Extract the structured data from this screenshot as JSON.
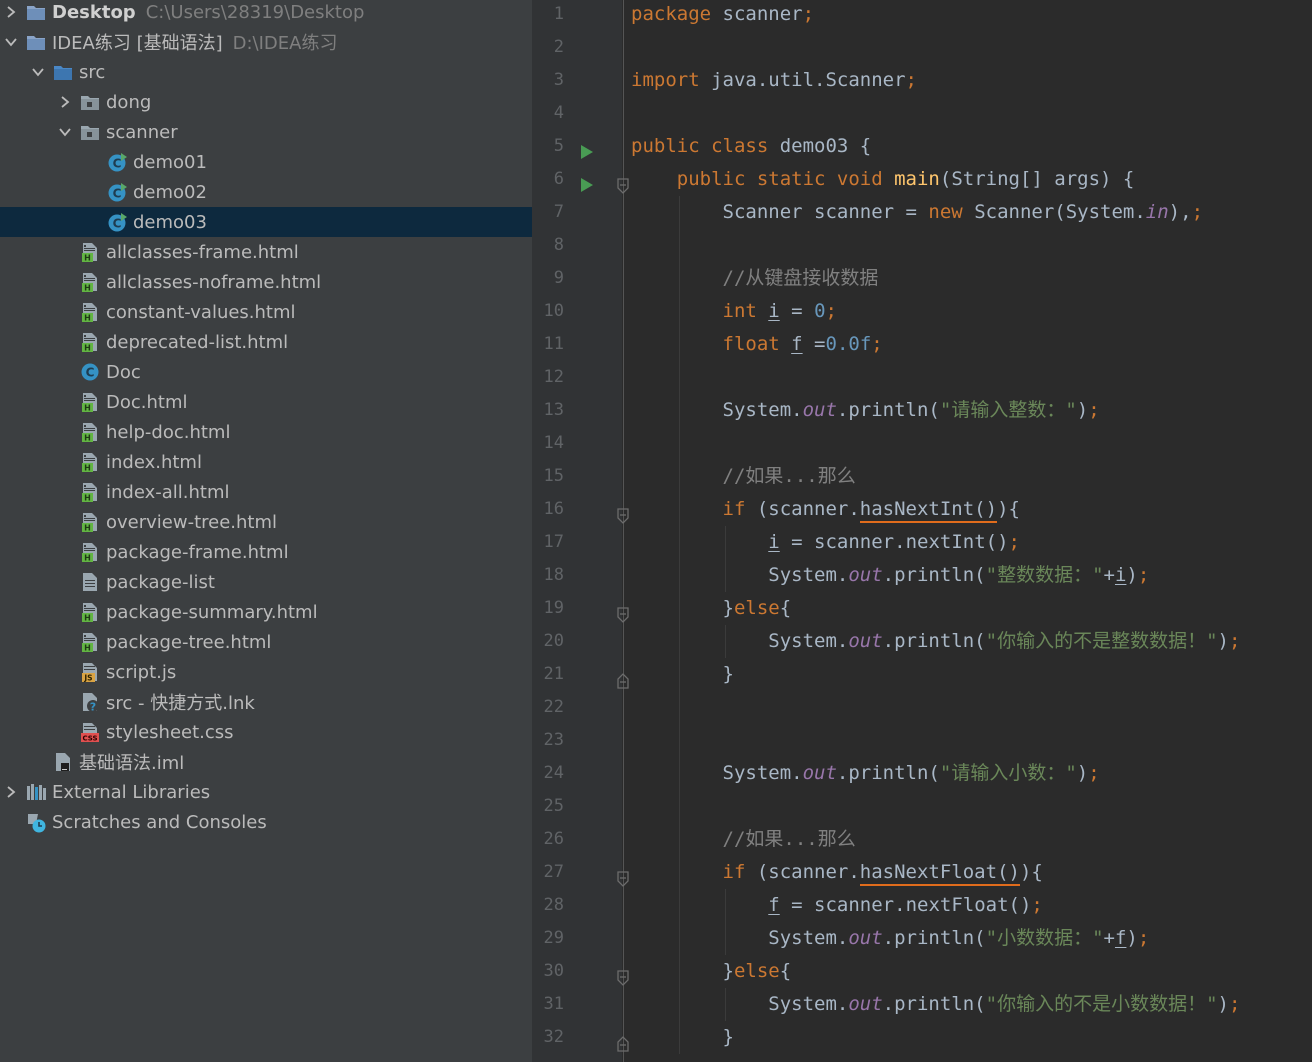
{
  "project_tree": [
    {
      "label": "Desktop",
      "hint": "C:\\Users\\28319\\Desktop",
      "depth": 0,
      "arrow": "right",
      "icon": "module-folder-icon",
      "bold": true
    },
    {
      "label": "IDEA练习 [基础语法]",
      "hint": "D:\\IDEA练习",
      "depth": 0,
      "arrow": "down",
      "icon": "module-folder-icon",
      "bold": false
    },
    {
      "label": "src",
      "hint": "",
      "depth": 1,
      "arrow": "down",
      "icon": "source-folder-icon"
    },
    {
      "label": "dong",
      "hint": "",
      "depth": 2,
      "arrow": "right",
      "icon": "package-icon"
    },
    {
      "label": "scanner",
      "hint": "",
      "depth": 2,
      "arrow": "down",
      "icon": "package-icon"
    },
    {
      "label": "demo01",
      "hint": "",
      "depth": 3,
      "arrow": "",
      "icon": "java-class-run-icon"
    },
    {
      "label": "demo02",
      "hint": "",
      "depth": 3,
      "arrow": "",
      "icon": "java-class-run-icon"
    },
    {
      "label": "demo03",
      "hint": "",
      "depth": 3,
      "arrow": "",
      "icon": "java-class-run-icon",
      "selected": true
    },
    {
      "label": "allclasses-frame.html",
      "hint": "",
      "depth": 2,
      "arrow": "",
      "icon": "html-file-icon"
    },
    {
      "label": "allclasses-noframe.html",
      "hint": "",
      "depth": 2,
      "arrow": "",
      "icon": "html-file-icon"
    },
    {
      "label": "constant-values.html",
      "hint": "",
      "depth": 2,
      "arrow": "",
      "icon": "html-file-icon"
    },
    {
      "label": "deprecated-list.html",
      "hint": "",
      "depth": 2,
      "arrow": "",
      "icon": "html-file-icon"
    },
    {
      "label": "Doc",
      "hint": "",
      "depth": 2,
      "arrow": "",
      "icon": "java-class-icon"
    },
    {
      "label": "Doc.html",
      "hint": "",
      "depth": 2,
      "arrow": "",
      "icon": "html-file-icon"
    },
    {
      "label": "help-doc.html",
      "hint": "",
      "depth": 2,
      "arrow": "",
      "icon": "html-file-icon"
    },
    {
      "label": "index.html",
      "hint": "",
      "depth": 2,
      "arrow": "",
      "icon": "html-file-icon"
    },
    {
      "label": "index-all.html",
      "hint": "",
      "depth": 2,
      "arrow": "",
      "icon": "html-file-icon"
    },
    {
      "label": "overview-tree.html",
      "hint": "",
      "depth": 2,
      "arrow": "",
      "icon": "html-file-icon"
    },
    {
      "label": "package-frame.html",
      "hint": "",
      "depth": 2,
      "arrow": "",
      "icon": "html-file-icon"
    },
    {
      "label": "package-list",
      "hint": "",
      "depth": 2,
      "arrow": "",
      "icon": "text-file-icon"
    },
    {
      "label": "package-summary.html",
      "hint": "",
      "depth": 2,
      "arrow": "",
      "icon": "html-file-icon"
    },
    {
      "label": "package-tree.html",
      "hint": "",
      "depth": 2,
      "arrow": "",
      "icon": "html-file-icon"
    },
    {
      "label": "script.js",
      "hint": "",
      "depth": 2,
      "arrow": "",
      "icon": "js-file-icon"
    },
    {
      "label": "src - 快捷方式.lnk",
      "hint": "",
      "depth": 2,
      "arrow": "",
      "icon": "unknown-file-icon"
    },
    {
      "label": "stylesheet.css",
      "hint": "",
      "depth": 2,
      "arrow": "",
      "icon": "css-file-icon"
    },
    {
      "label": "基础语法.iml",
      "hint": "",
      "depth": 1,
      "arrow": "",
      "icon": "iml-file-icon"
    },
    {
      "label": "External Libraries",
      "hint": "",
      "depth": 0,
      "arrow": "right",
      "icon": "libraries-icon"
    },
    {
      "label": "Scratches and Consoles",
      "hint": "",
      "depth": 0,
      "arrow": "",
      "icon": "scratches-icon"
    }
  ],
  "editor": {
    "lines": [
      {
        "n": "1",
        "run": false,
        "fold": "",
        "guides": [],
        "tokens": [
          [
            "kw",
            "package "
          ],
          [
            "",
            "scanner"
          ],
          [
            "kw",
            ";"
          ]
        ]
      },
      {
        "n": "2",
        "run": false,
        "fold": "",
        "guides": [],
        "tokens": []
      },
      {
        "n": "3",
        "run": false,
        "fold": "",
        "guides": [],
        "tokens": [
          [
            "kw",
            "import "
          ],
          [
            "",
            "java.util.Scanner"
          ],
          [
            "kw",
            ";"
          ]
        ]
      },
      {
        "n": "4",
        "run": false,
        "fold": "",
        "guides": [],
        "tokens": []
      },
      {
        "n": "5",
        "run": true,
        "fold": "",
        "guides": [],
        "tokens": [
          [
            "kw",
            "public class "
          ],
          [
            "",
            "demo03 {"
          ]
        ]
      },
      {
        "n": "6",
        "run": true,
        "fold": "open",
        "guides": [],
        "tokens": [
          [
            "",
            "    "
          ],
          [
            "kw",
            "public static void "
          ],
          [
            "fn",
            "main"
          ],
          [
            "",
            "(String[] args) {"
          ]
        ]
      },
      {
        "n": "7",
        "run": false,
        "fold": "",
        "guides": [
          1
        ],
        "tokens": [
          [
            "",
            "        Scanner scanner = "
          ],
          [
            "kw",
            "new "
          ],
          [
            "",
            "Scanner(System."
          ],
          [
            "field",
            "in"
          ],
          [
            "",
            "),"
          ],
          [
            "kw",
            ";"
          ]
        ]
      },
      {
        "n": "8",
        "run": false,
        "fold": "",
        "guides": [
          1
        ],
        "tokens": []
      },
      {
        "n": "9",
        "run": false,
        "fold": "",
        "guides": [
          1
        ],
        "tokens": [
          [
            "",
            "        "
          ],
          [
            "cmt",
            "//从键盘接收数据"
          ]
        ]
      },
      {
        "n": "10",
        "run": false,
        "fold": "",
        "guides": [
          1
        ],
        "tokens": [
          [
            "",
            "        "
          ],
          [
            "kw",
            "int "
          ],
          [
            "var-ul",
            "i"
          ],
          [
            "",
            " = "
          ],
          [
            "num",
            "0"
          ],
          [
            "kw",
            ";"
          ]
        ]
      },
      {
        "n": "11",
        "run": false,
        "fold": "",
        "guides": [
          1
        ],
        "tokens": [
          [
            "",
            "        "
          ],
          [
            "kw",
            "float "
          ],
          [
            "var-ul",
            "f"
          ],
          [
            "",
            " ="
          ],
          [
            "num",
            "0.0f"
          ],
          [
            "kw",
            ";"
          ]
        ]
      },
      {
        "n": "12",
        "run": false,
        "fold": "",
        "guides": [
          1
        ],
        "tokens": []
      },
      {
        "n": "13",
        "run": false,
        "fold": "",
        "guides": [
          1
        ],
        "tokens": [
          [
            "",
            "        System."
          ],
          [
            "field",
            "out"
          ],
          [
            "",
            ".println("
          ],
          [
            "str",
            "\"请输入整数：\""
          ],
          [
            "",
            ")"
          ],
          [
            "kw",
            ";"
          ]
        ]
      },
      {
        "n": "14",
        "run": false,
        "fold": "",
        "guides": [
          1
        ],
        "tokens": []
      },
      {
        "n": "15",
        "run": false,
        "fold": "",
        "guides": [
          1
        ],
        "tokens": [
          [
            "",
            "        "
          ],
          [
            "cmt",
            "//如果...那么"
          ]
        ]
      },
      {
        "n": "16",
        "run": false,
        "fold": "open",
        "guides": [
          1
        ],
        "tokens": [
          [
            "",
            "        "
          ],
          [
            "kw",
            "if "
          ],
          [
            "",
            "(scanner."
          ],
          [
            "squiggle",
            "hasNextInt()"
          ],
          [
            "",
            ")"
          ],
          [
            "",
            "{"
          ]
        ]
      },
      {
        "n": "17",
        "run": false,
        "fold": "",
        "guides": [
          1,
          2
        ],
        "tokens": [
          [
            "",
            "            "
          ],
          [
            "var-ul",
            "i"
          ],
          [
            "",
            " = scanner.nextInt()"
          ],
          [
            "kw",
            ";"
          ]
        ]
      },
      {
        "n": "18",
        "run": false,
        "fold": "",
        "guides": [
          1,
          2
        ],
        "tokens": [
          [
            "",
            "            System."
          ],
          [
            "field",
            "out"
          ],
          [
            "",
            ".println("
          ],
          [
            "str",
            "\"整数数据：\""
          ],
          [
            "",
            "+"
          ],
          [
            "var-ul",
            "i"
          ],
          [
            "",
            ")"
          ],
          [
            "kw",
            ";"
          ]
        ]
      },
      {
        "n": "19",
        "run": false,
        "fold": "mid",
        "guides": [
          1
        ],
        "tokens": [
          [
            "",
            "        }"
          ],
          [
            "kw",
            "else"
          ],
          [
            "",
            "{"
          ]
        ]
      },
      {
        "n": "20",
        "run": false,
        "fold": "",
        "guides": [
          1,
          2
        ],
        "tokens": [
          [
            "",
            "            System."
          ],
          [
            "field",
            "out"
          ],
          [
            "",
            ".println("
          ],
          [
            "str",
            "\"你输入的不是整数数据！\""
          ],
          [
            "",
            ")"
          ],
          [
            "kw",
            ";"
          ]
        ]
      },
      {
        "n": "21",
        "run": false,
        "fold": "close",
        "guides": [
          1
        ],
        "tokens": [
          [
            "",
            "        }"
          ]
        ]
      },
      {
        "n": "22",
        "run": false,
        "fold": "",
        "guides": [
          1
        ],
        "tokens": []
      },
      {
        "n": "23",
        "run": false,
        "fold": "",
        "guides": [
          1
        ],
        "tokens": []
      },
      {
        "n": "24",
        "run": false,
        "fold": "",
        "guides": [
          1
        ],
        "tokens": [
          [
            "",
            "        System."
          ],
          [
            "field",
            "out"
          ],
          [
            "",
            ".println("
          ],
          [
            "str",
            "\"请输入小数：\""
          ],
          [
            "",
            ")"
          ],
          [
            "kw",
            ";"
          ]
        ]
      },
      {
        "n": "25",
        "run": false,
        "fold": "",
        "guides": [
          1
        ],
        "tokens": []
      },
      {
        "n": "26",
        "run": false,
        "fold": "",
        "guides": [
          1
        ],
        "tokens": [
          [
            "",
            "        "
          ],
          [
            "cmt",
            "//如果...那么"
          ]
        ]
      },
      {
        "n": "27",
        "run": false,
        "fold": "open",
        "guides": [
          1
        ],
        "tokens": [
          [
            "",
            "        "
          ],
          [
            "kw",
            "if "
          ],
          [
            "",
            "(scanner."
          ],
          [
            "squiggle",
            "hasNextFloat()"
          ],
          [
            "",
            ")"
          ],
          [
            "",
            "{"
          ]
        ]
      },
      {
        "n": "28",
        "run": false,
        "fold": "",
        "guides": [
          1,
          2
        ],
        "tokens": [
          [
            "",
            "            "
          ],
          [
            "var-ul",
            "f"
          ],
          [
            "",
            " = scanner.nextFloat()"
          ],
          [
            "kw",
            ";"
          ]
        ]
      },
      {
        "n": "29",
        "run": false,
        "fold": "",
        "guides": [
          1,
          2
        ],
        "tokens": [
          [
            "",
            "            System."
          ],
          [
            "field",
            "out"
          ],
          [
            "",
            ".println("
          ],
          [
            "str",
            "\"小数数据：\""
          ],
          [
            "",
            "+"
          ],
          [
            "var-ul",
            "f"
          ],
          [
            "",
            ")"
          ],
          [
            "kw",
            ";"
          ]
        ]
      },
      {
        "n": "30",
        "run": false,
        "fold": "mid",
        "guides": [
          1
        ],
        "tokens": [
          [
            "",
            "        }"
          ],
          [
            "kw",
            "else"
          ],
          [
            "",
            "{"
          ]
        ]
      },
      {
        "n": "31",
        "run": false,
        "fold": "",
        "guides": [
          1,
          2
        ],
        "tokens": [
          [
            "",
            "            System."
          ],
          [
            "field",
            "out"
          ],
          [
            "",
            ".println("
          ],
          [
            "str",
            "\"你输入的不是小数数据！\""
          ],
          [
            "",
            ")"
          ],
          [
            "kw",
            ";"
          ]
        ]
      },
      {
        "n": "32",
        "run": false,
        "fold": "close",
        "guides": [
          1
        ],
        "tokens": [
          [
            "",
            "        }"
          ]
        ]
      }
    ]
  },
  "colors": {
    "panel_bg": "#3c3f41",
    "editor_bg": "#2b2b2b",
    "selection": "#0d293e",
    "keyword": "#cc7832",
    "string": "#6a8759",
    "number": "#6897bb",
    "field": "#9876aa",
    "method_decl": "#ffc66d",
    "warning_underline": "#e06c1c"
  }
}
